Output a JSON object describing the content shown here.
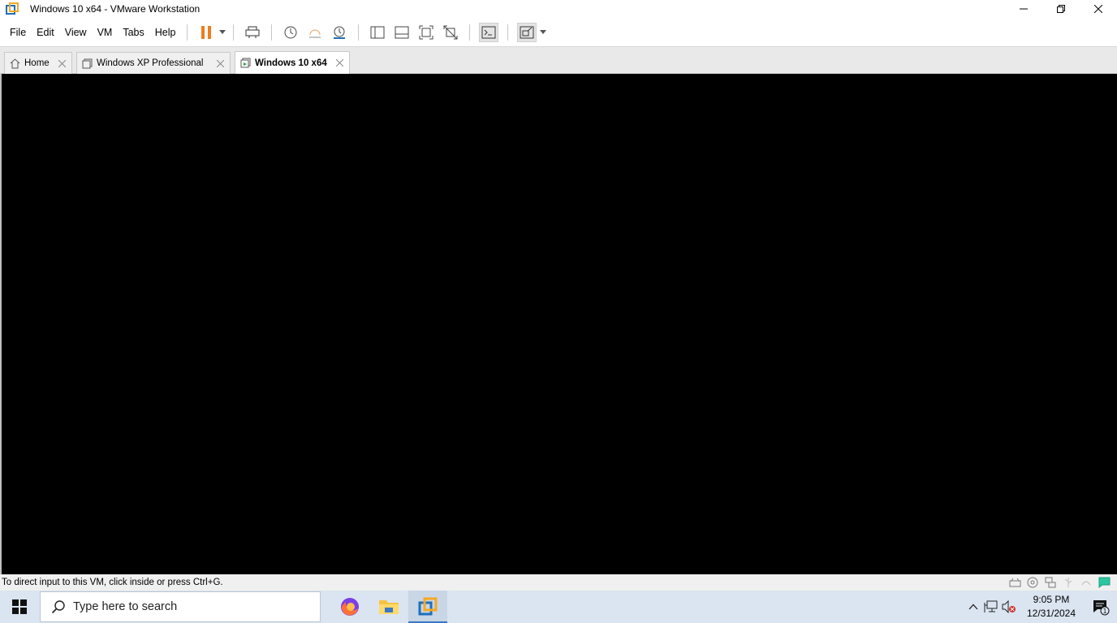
{
  "window": {
    "title": "Windows 10 x64 - VMware Workstation"
  },
  "menu": [
    "File",
    "Edit",
    "View",
    "VM",
    "Tabs",
    "Help"
  ],
  "tabs": [
    {
      "label": "Home",
      "active": false
    },
    {
      "label": "Windows XP Professional",
      "active": false
    },
    {
      "label": "Windows 10 x64",
      "active": true
    }
  ],
  "status": {
    "message": "To direct input to this VM, click inside or press Ctrl+G."
  },
  "taskbar": {
    "search_placeholder": "Type here to search",
    "time": "9:05 PM",
    "date": "12/31/2024",
    "notification_count": "1"
  },
  "colors": {
    "accent_orange": "#f07c1e",
    "vm_background": "#000000",
    "taskbar_bg": "#dbe5f1",
    "vmware_blue": "#1f6fb9"
  }
}
